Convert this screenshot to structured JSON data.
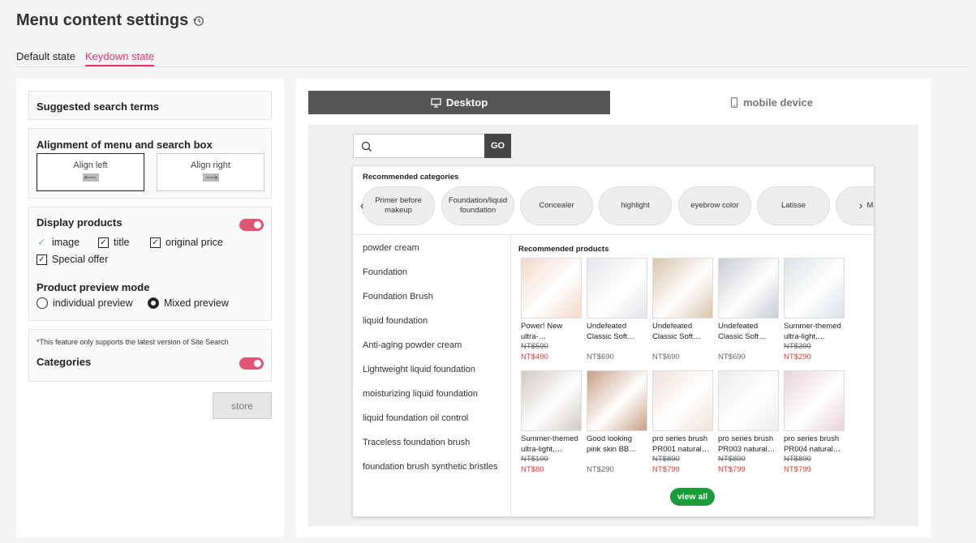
{
  "page": {
    "title": "Menu content settings"
  },
  "tabs": [
    {
      "label": "Default state"
    },
    {
      "label": "Keydown state"
    }
  ],
  "left": {
    "suggested_terms": "Suggested search terms",
    "alignment_title": "Alignment of menu and search box",
    "align_left": "Align left",
    "align_right": "Align right",
    "display_products": "Display products",
    "opt_image": "image",
    "opt_title": "title",
    "opt_original_price": "original price",
    "opt_special_offer": "Special offer",
    "preview_mode_title": "Product preview mode",
    "preview_individual": "individual preview",
    "preview_mixed": "Mixed preview",
    "note": "*This feature only supports the latest version of Site Search",
    "categories": "Categories",
    "store": "store"
  },
  "view_tabs": {
    "desktop": "Desktop",
    "mobile": "mobile device"
  },
  "search": {
    "go": "GO"
  },
  "dropdown": {
    "categories_title": "Recommended categories",
    "categories": [
      "Primer before makeup",
      "Foundation/liquid foundation",
      "Concealer",
      "highlight",
      "eyebrow color",
      "Latisse",
      "Ma"
    ],
    "suggestions": [
      "powder cream",
      "Foundation",
      "Foundation Brush",
      "liquid foundation",
      "Anti-aging powder cream",
      "Lightweight liquid foundation",
      "moisturizing liquid foundation",
      "liquid foundation oil control",
      "Traceless foundation brush",
      "foundation brush synthetic bristles"
    ],
    "products_title": "Recommended products",
    "products": [
      {
        "name": "Power! New ultra-concealing…",
        "orig": "NT$590",
        "price": "NT$490",
        "sale": true,
        "color": "#f3d9c9"
      },
      {
        "name": "Undefeated Classic Soft Mis…",
        "orig": "",
        "price": "NT$690",
        "sale": false,
        "color": "#e3e6ea"
      },
      {
        "name": "Undefeated Classic Soft Mis…",
        "orig": "",
        "price": "NT$690",
        "sale": false,
        "color": "#d9c4ac"
      },
      {
        "name": "Undefeated Classic Soft Mis…",
        "orig": "",
        "price": "NT$690",
        "sale": false,
        "color": "#c7cbd1"
      },
      {
        "name": "Summer-themed ultra-light,…",
        "orig": "NT$390",
        "price": "NT$290",
        "sale": true,
        "color": "#dbe2e5"
      },
      {
        "name": "Summer-themed ultra-light,…",
        "orig": "NT$100",
        "price": "NT$80",
        "sale": true,
        "color": "#cfc9c2"
      },
      {
        "name": "Good looking pink skin BB…",
        "orig": "",
        "price": "NT$290",
        "sale": false,
        "color": "#c89f86"
      },
      {
        "name": "pro series brush PR001 natural…",
        "orig": "NT$890",
        "price": "NT$799",
        "sale": true,
        "color": "#f1e2da"
      },
      {
        "name": "pro series brush PR003 natural…",
        "orig": "NT$890",
        "price": "NT$799",
        "sale": true,
        "color": "#ececec"
      },
      {
        "name": "pro series brush PR004 natural…",
        "orig": "NT$890",
        "price": "NT$799",
        "sale": true,
        "color": "#e8d4d8"
      }
    ],
    "view_all": "view all"
  },
  "colors": {
    "accent": "#e5336e",
    "toggle": "#e25476",
    "green": "#1a9c3a",
    "sale": "#e53935"
  }
}
